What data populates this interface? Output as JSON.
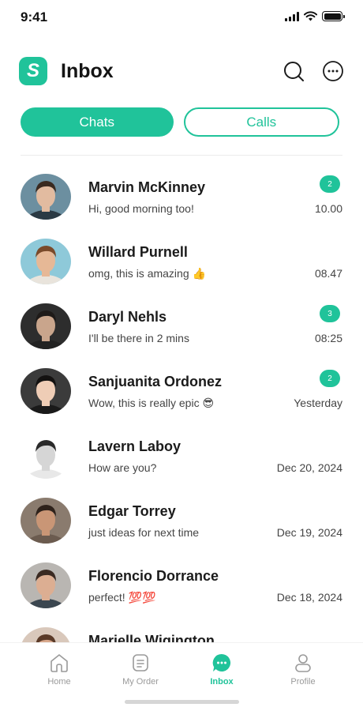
{
  "status_bar": {
    "time": "9:41"
  },
  "header": {
    "logo_letter": "S",
    "title": "Inbox",
    "icons": [
      "search-icon",
      "more-options-icon"
    ]
  },
  "tabs": [
    {
      "label": "Chats",
      "active": true
    },
    {
      "label": "Calls",
      "active": false
    }
  ],
  "chats": [
    {
      "name": "Marvin McKinney",
      "message": "Hi, good morning too!",
      "time": "10.00",
      "badge": "2",
      "avatar_skin": "#e2bba0",
      "avatar_hair": "#3a2a20",
      "avatar_bg": "#6c8fa0",
      "avatar_shirt": "#2b3a44"
    },
    {
      "name": "Willard Purnell",
      "message": "omg, this is amazing 👍",
      "time": "08.47",
      "badge": "",
      "avatar_skin": "#e6b896",
      "avatar_hair": "#7a4a2a",
      "avatar_bg": "#8ec9d9",
      "avatar_shirt": "#e9e4dc"
    },
    {
      "name": "Daryl Nehls",
      "message": "I'll be there in 2 mins",
      "time": "08:25",
      "badge": "3",
      "avatar_skin": "#c9a58c",
      "avatar_hair": "#1e1a18",
      "avatar_bg": "#2d2d2d",
      "avatar_shirt": "#222222"
    },
    {
      "name": "Sanjuanita Ordonez",
      "message": "Wow, this is really epic 😎",
      "time": "Yesterday",
      "badge": "2",
      "avatar_skin": "#efcdb6",
      "avatar_hair": "#141211",
      "avatar_bg": "#3b3b3b",
      "avatar_shirt": "#1a1a1a"
    },
    {
      "name": "Lavern Laboy",
      "message": "How are you?",
      "time": "Dec 20, 2024",
      "badge": "",
      "avatar_skin": "#d6d6d6",
      "avatar_hair": "#2a2a2a",
      "avatar_bg": "#ffffff",
      "avatar_shirt": "#e8e8e8"
    },
    {
      "name": "Edgar Torrey",
      "message": "just ideas for next time",
      "time": "Dec 19, 2024",
      "badge": "",
      "avatar_skin": "#c99676",
      "avatar_hair": "#2e221b",
      "avatar_bg": "#8a7b6e",
      "avatar_shirt": "#6b5b4f"
    },
    {
      "name": "Florencio Dorrance",
      "message": "perfect! 💯💯",
      "time": "Dec 18, 2024",
      "badge": "",
      "avatar_skin": "#dcae92",
      "avatar_hair": "#3a2a22",
      "avatar_bg": "#b9b6b2",
      "avatar_shirt": "#3b4650"
    },
    {
      "name": "Marielle Wigington",
      "message": "",
      "time": "",
      "badge": "",
      "avatar_skin": "#d8a88c",
      "avatar_hair": "#5a3a28",
      "avatar_bg": "#d9c8bb",
      "avatar_shirt": "#cfc5bb"
    }
  ],
  "nav": [
    {
      "label": "Home",
      "icon": "home-icon",
      "active": false
    },
    {
      "label": "My Order",
      "icon": "order-icon",
      "active": false
    },
    {
      "label": "Inbox",
      "icon": "inbox-chat-icon",
      "active": true
    },
    {
      "label": "Profile",
      "icon": "profile-icon",
      "active": false
    }
  ],
  "colors": {
    "accent": "#20c39a",
    "text": "#1b1b1b",
    "muted": "#9a9a9a"
  }
}
